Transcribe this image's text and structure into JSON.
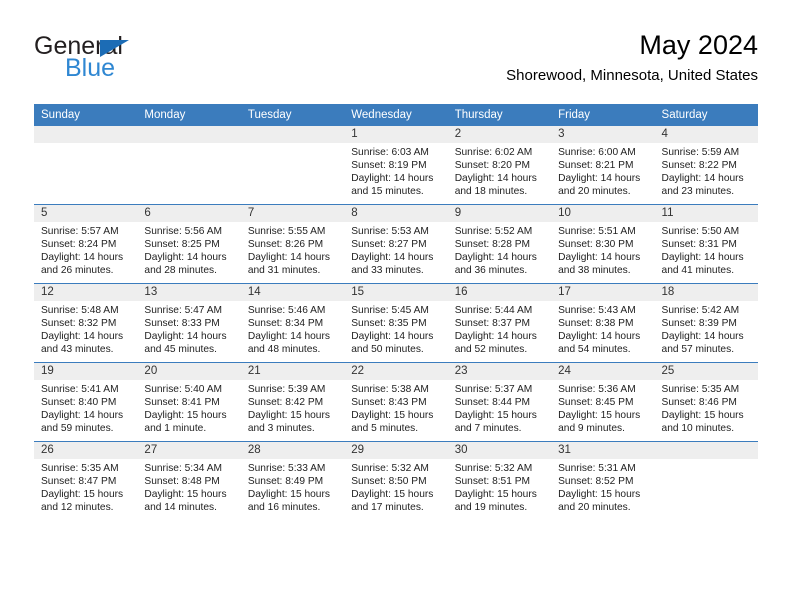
{
  "brand": {
    "name_dark": "General",
    "name_blue": "Blue",
    "triangle_icon": "triangle-icon",
    "accent_dark": "#231f20",
    "accent_blue": "#2f87d2",
    "triangle_color": "#1c6cb5"
  },
  "header": {
    "title": "May 2024",
    "subtitle": "Shorewood, Minnesota, United States"
  },
  "theme": {
    "header_blue": "#3b7cbd",
    "day_head_gray": "#eeeeee",
    "text": "#222222"
  },
  "weekdays": [
    "Sunday",
    "Monday",
    "Tuesday",
    "Wednesday",
    "Thursday",
    "Friday",
    "Saturday"
  ],
  "weeks": [
    [
      {
        "day": "",
        "sunrise": "",
        "sunset": "",
        "daylight_line1": "",
        "daylight_line2": "",
        "empty": true
      },
      {
        "day": "",
        "sunrise": "",
        "sunset": "",
        "daylight_line1": "",
        "daylight_line2": "",
        "empty": true
      },
      {
        "day": "",
        "sunrise": "",
        "sunset": "",
        "daylight_line1": "",
        "daylight_line2": "",
        "empty": true
      },
      {
        "day": "1",
        "sunrise": "Sunrise: 6:03 AM",
        "sunset": "Sunset: 8:19 PM",
        "daylight_line1": "Daylight: 14 hours",
        "daylight_line2": "and 15 minutes.",
        "empty": false
      },
      {
        "day": "2",
        "sunrise": "Sunrise: 6:02 AM",
        "sunset": "Sunset: 8:20 PM",
        "daylight_line1": "Daylight: 14 hours",
        "daylight_line2": "and 18 minutes.",
        "empty": false
      },
      {
        "day": "3",
        "sunrise": "Sunrise: 6:00 AM",
        "sunset": "Sunset: 8:21 PM",
        "daylight_line1": "Daylight: 14 hours",
        "daylight_line2": "and 20 minutes.",
        "empty": false
      },
      {
        "day": "4",
        "sunrise": "Sunrise: 5:59 AM",
        "sunset": "Sunset: 8:22 PM",
        "daylight_line1": "Daylight: 14 hours",
        "daylight_line2": "and 23 minutes.",
        "empty": false
      }
    ],
    [
      {
        "day": "5",
        "sunrise": "Sunrise: 5:57 AM",
        "sunset": "Sunset: 8:24 PM",
        "daylight_line1": "Daylight: 14 hours",
        "daylight_line2": "and 26 minutes.",
        "empty": false
      },
      {
        "day": "6",
        "sunrise": "Sunrise: 5:56 AM",
        "sunset": "Sunset: 8:25 PM",
        "daylight_line1": "Daylight: 14 hours",
        "daylight_line2": "and 28 minutes.",
        "empty": false
      },
      {
        "day": "7",
        "sunrise": "Sunrise: 5:55 AM",
        "sunset": "Sunset: 8:26 PM",
        "daylight_line1": "Daylight: 14 hours",
        "daylight_line2": "and 31 minutes.",
        "empty": false
      },
      {
        "day": "8",
        "sunrise": "Sunrise: 5:53 AM",
        "sunset": "Sunset: 8:27 PM",
        "daylight_line1": "Daylight: 14 hours",
        "daylight_line2": "and 33 minutes.",
        "empty": false
      },
      {
        "day": "9",
        "sunrise": "Sunrise: 5:52 AM",
        "sunset": "Sunset: 8:28 PM",
        "daylight_line1": "Daylight: 14 hours",
        "daylight_line2": "and 36 minutes.",
        "empty": false
      },
      {
        "day": "10",
        "sunrise": "Sunrise: 5:51 AM",
        "sunset": "Sunset: 8:30 PM",
        "daylight_line1": "Daylight: 14 hours",
        "daylight_line2": "and 38 minutes.",
        "empty": false
      },
      {
        "day": "11",
        "sunrise": "Sunrise: 5:50 AM",
        "sunset": "Sunset: 8:31 PM",
        "daylight_line1": "Daylight: 14 hours",
        "daylight_line2": "and 41 minutes.",
        "empty": false
      }
    ],
    [
      {
        "day": "12",
        "sunrise": "Sunrise: 5:48 AM",
        "sunset": "Sunset: 8:32 PM",
        "daylight_line1": "Daylight: 14 hours",
        "daylight_line2": "and 43 minutes.",
        "empty": false
      },
      {
        "day": "13",
        "sunrise": "Sunrise: 5:47 AM",
        "sunset": "Sunset: 8:33 PM",
        "daylight_line1": "Daylight: 14 hours",
        "daylight_line2": "and 45 minutes.",
        "empty": false
      },
      {
        "day": "14",
        "sunrise": "Sunrise: 5:46 AM",
        "sunset": "Sunset: 8:34 PM",
        "daylight_line1": "Daylight: 14 hours",
        "daylight_line2": "and 48 minutes.",
        "empty": false
      },
      {
        "day": "15",
        "sunrise": "Sunrise: 5:45 AM",
        "sunset": "Sunset: 8:35 PM",
        "daylight_line1": "Daylight: 14 hours",
        "daylight_line2": "and 50 minutes.",
        "empty": false
      },
      {
        "day": "16",
        "sunrise": "Sunrise: 5:44 AM",
        "sunset": "Sunset: 8:37 PM",
        "daylight_line1": "Daylight: 14 hours",
        "daylight_line2": "and 52 minutes.",
        "empty": false
      },
      {
        "day": "17",
        "sunrise": "Sunrise: 5:43 AM",
        "sunset": "Sunset: 8:38 PM",
        "daylight_line1": "Daylight: 14 hours",
        "daylight_line2": "and 54 minutes.",
        "empty": false
      },
      {
        "day": "18",
        "sunrise": "Sunrise: 5:42 AM",
        "sunset": "Sunset: 8:39 PM",
        "daylight_line1": "Daylight: 14 hours",
        "daylight_line2": "and 57 minutes.",
        "empty": false
      }
    ],
    [
      {
        "day": "19",
        "sunrise": "Sunrise: 5:41 AM",
        "sunset": "Sunset: 8:40 PM",
        "daylight_line1": "Daylight: 14 hours",
        "daylight_line2": "and 59 minutes.",
        "empty": false
      },
      {
        "day": "20",
        "sunrise": "Sunrise: 5:40 AM",
        "sunset": "Sunset: 8:41 PM",
        "daylight_line1": "Daylight: 15 hours",
        "daylight_line2": "and 1 minute.",
        "empty": false
      },
      {
        "day": "21",
        "sunrise": "Sunrise: 5:39 AM",
        "sunset": "Sunset: 8:42 PM",
        "daylight_line1": "Daylight: 15 hours",
        "daylight_line2": "and 3 minutes.",
        "empty": false
      },
      {
        "day": "22",
        "sunrise": "Sunrise: 5:38 AM",
        "sunset": "Sunset: 8:43 PM",
        "daylight_line1": "Daylight: 15 hours",
        "daylight_line2": "and 5 minutes.",
        "empty": false
      },
      {
        "day": "23",
        "sunrise": "Sunrise: 5:37 AM",
        "sunset": "Sunset: 8:44 PM",
        "daylight_line1": "Daylight: 15 hours",
        "daylight_line2": "and 7 minutes.",
        "empty": false
      },
      {
        "day": "24",
        "sunrise": "Sunrise: 5:36 AM",
        "sunset": "Sunset: 8:45 PM",
        "daylight_line1": "Daylight: 15 hours",
        "daylight_line2": "and 9 minutes.",
        "empty": false
      },
      {
        "day": "25",
        "sunrise": "Sunrise: 5:35 AM",
        "sunset": "Sunset: 8:46 PM",
        "daylight_line1": "Daylight: 15 hours",
        "daylight_line2": "and 10 minutes.",
        "empty": false
      }
    ],
    [
      {
        "day": "26",
        "sunrise": "Sunrise: 5:35 AM",
        "sunset": "Sunset: 8:47 PM",
        "daylight_line1": "Daylight: 15 hours",
        "daylight_line2": "and 12 minutes.",
        "empty": false
      },
      {
        "day": "27",
        "sunrise": "Sunrise: 5:34 AM",
        "sunset": "Sunset: 8:48 PM",
        "daylight_line1": "Daylight: 15 hours",
        "daylight_line2": "and 14 minutes.",
        "empty": false
      },
      {
        "day": "28",
        "sunrise": "Sunrise: 5:33 AM",
        "sunset": "Sunset: 8:49 PM",
        "daylight_line1": "Daylight: 15 hours",
        "daylight_line2": "and 16 minutes.",
        "empty": false
      },
      {
        "day": "29",
        "sunrise": "Sunrise: 5:32 AM",
        "sunset": "Sunset: 8:50 PM",
        "daylight_line1": "Daylight: 15 hours",
        "daylight_line2": "and 17 minutes.",
        "empty": false
      },
      {
        "day": "30",
        "sunrise": "Sunrise: 5:32 AM",
        "sunset": "Sunset: 8:51 PM",
        "daylight_line1": "Daylight: 15 hours",
        "daylight_line2": "and 19 minutes.",
        "empty": false
      },
      {
        "day": "31",
        "sunrise": "Sunrise: 5:31 AM",
        "sunset": "Sunset: 8:52 PM",
        "daylight_line1": "Daylight: 15 hours",
        "daylight_line2": "and 20 minutes.",
        "empty": false
      },
      {
        "day": "",
        "sunrise": "",
        "sunset": "",
        "daylight_line1": "",
        "daylight_line2": "",
        "empty": true
      }
    ]
  ]
}
